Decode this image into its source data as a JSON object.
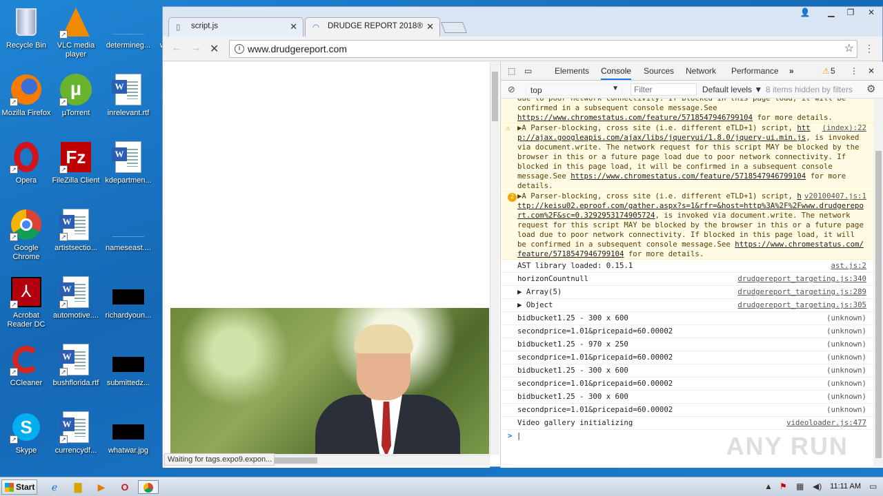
{
  "desktop": {
    "icons": [
      {
        "label": "Recycle Bin",
        "icon": "recycle-bin-icon"
      },
      {
        "label": "VLC media player",
        "icon": "vlc-icon"
      },
      {
        "label": "determineg...",
        "icon": "blank-file-icon"
      },
      {
        "label": "w",
        "icon": "blank-file-icon"
      },
      {
        "label": "Mozilla Firefox",
        "icon": "firefox-icon"
      },
      {
        "label": "µTorrent",
        "icon": "utorrent-icon"
      },
      {
        "label": "inrelevant.rtf",
        "icon": "word-doc-icon"
      },
      {
        "label": "Opera",
        "icon": "opera-icon"
      },
      {
        "label": "FileZilla Client",
        "icon": "filezilla-icon"
      },
      {
        "label": "kdepartmen...",
        "icon": "word-doc-icon"
      },
      {
        "label": "Google Chrome",
        "icon": "chrome-icon"
      },
      {
        "label": "artistsectio...",
        "icon": "word-doc-icon"
      },
      {
        "label": "nameseast....",
        "icon": "blank-file-icon"
      },
      {
        "label": "Acrobat Reader DC",
        "icon": "acrobat-icon"
      },
      {
        "label": "automotive....",
        "icon": "word-doc-icon"
      },
      {
        "label": "richardyoun...",
        "icon": "black-thumbnail-icon"
      },
      {
        "label": "CCleaner",
        "icon": "ccleaner-icon"
      },
      {
        "label": "bushflorida.rtf",
        "icon": "word-doc-icon"
      },
      {
        "label": "submittedz...",
        "icon": "black-thumbnail-icon"
      },
      {
        "label": "Skype",
        "icon": "skype-icon"
      },
      {
        "label": "currencydf...",
        "icon": "word-doc-icon"
      },
      {
        "label": "whatwar.jpg",
        "icon": "black-thumbnail-icon"
      }
    ]
  },
  "browser": {
    "tabs": [
      {
        "title": "script.js",
        "icon": "file-icon"
      },
      {
        "title": "DRUDGE REPORT 2018®",
        "icon": "loading-spinner-icon"
      }
    ],
    "url": "www.drudgereport.com",
    "status_text": "Waiting for tags.expo9.expon..."
  },
  "devtools": {
    "tabs": [
      "Elements",
      "Console",
      "Sources",
      "Network",
      "Performance"
    ],
    "more_tabs": "»",
    "warning_count": "5",
    "context": "top",
    "filter_placeholder": "Filter",
    "levels": "Default levels",
    "hidden": "8 items hidden by filters",
    "warnings": [
      {
        "text_top": "due to poor network connectivity. If blocked in this page load, it will be confirmed in a subsequent console message.See",
        "link": "https://www.chromestatus.com/feature/5718547946799104",
        "tail": "for more details."
      },
      {
        "prefix": "▶A Parser-blocking, cross site (i.e. different eTLD+1)",
        "source": "(index):22",
        "line2": "script,",
        "link1": "http://ajax.googleapis.com/ajax/libs/jqueryui/1.8.0/jquery-ui.min.js",
        "body": ", is invoked via document.write. The network request for this script MAY be blocked by the browser in this or a future page load due to poor network connectivity. If blocked in this page load, it will be confirmed in a subsequent console message.See",
        "link2": "https://www.chromestatus.com/feature/5718547946799104",
        "tail": "for more details."
      },
      {
        "badge": "2",
        "prefix": "▶A Parser-blocking, cross site (i.e. different",
        "source": "v20100407.js:1",
        "line2": "eTLD+1) script,",
        "link1": "http://keisu02.eproof.com/gather.aspx?s=1&rfr=&host=http%3A%2F%2Fwww.drudgereport.com%2F&sc=0.3292953174905724",
        "body": ", is invoked via document.write. The network request for this script MAY be blocked by the browser in this or a future page load due to poor network connectivity. If blocked in this page load, it will be confirmed in a subsequent console message.See",
        "link2": "https://www.chromestatus.com/feature/5718547946799104",
        "tail": "for more details."
      }
    ],
    "messages": [
      {
        "text": "AST library loaded: 0.15.1",
        "source": "ast.js:2"
      },
      {
        "text": "horizonCountnull",
        "source": "drudgereport_targeting.js:340"
      },
      {
        "text": "▶ Array(5)",
        "source": "drudgereport_targeting.js:289"
      },
      {
        "text": "▶ Object",
        "source": "drudgereport_targeting.js:305"
      },
      {
        "text": "bidbucket1.25 - 300 x 600",
        "source": "(unknown)"
      },
      {
        "text": "secondprice=1.01&pricepaid=60.00002",
        "source": "(unknown)"
      },
      {
        "text": "bidbucket1.25 - 970 x 250",
        "source": "(unknown)"
      },
      {
        "text": "secondprice=1.01&pricepaid=60.00002",
        "source": "(unknown)"
      },
      {
        "text": "bidbucket1.25 - 300 x 600",
        "source": "(unknown)"
      },
      {
        "text": "secondprice=1.01&pricepaid=60.00002",
        "source": "(unknown)"
      },
      {
        "text": "bidbucket1.25 - 300 x 600",
        "source": "(unknown)"
      },
      {
        "text": "secondprice=1.01&pricepaid=60.00002",
        "source": "(unknown)"
      },
      {
        "text": "Video gallery initializing",
        "source": "videoloader.js:477"
      }
    ],
    "prompt": ">"
  },
  "watermark": "ANY RUN",
  "taskbar": {
    "start_label": "Start",
    "clock": "11:11 AM"
  }
}
